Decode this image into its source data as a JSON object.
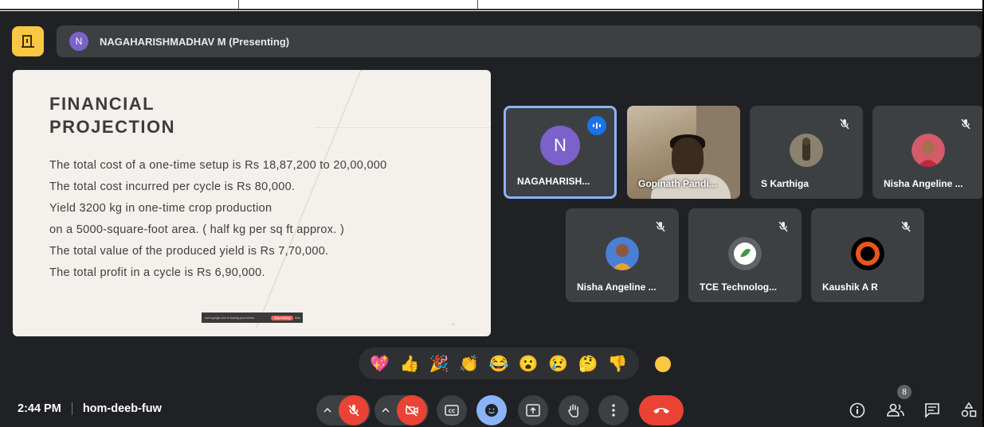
{
  "header": {
    "presenter_initial": "N",
    "presenter_text": "NAGAHARISHMADHAV M (Presenting)"
  },
  "slide": {
    "title_line1": "FINANCIAL",
    "title_line2": "PROJECTION",
    "lines": [
      "The total cost of a one-time setup is Rs 18,87,200 to 20,00,000",
      "The total cost incurred per cycle is Rs 80,000.",
      "Yield 3200 kg in one-time crop production",
      "on a 5000-square-foot area. ( half kg per sq ft approx. )",
      "The total value of the produced yield is Rs 7,70,000.",
      "The total profit in a cycle is Rs 6,90,000."
    ],
    "sharebar_text": "meet.google.com is sharing your screen.",
    "sharebar_stop": "Stop sharing",
    "sharebar_hide": "Hide"
  },
  "participants": [
    {
      "name": "NAGAHARISH...",
      "initial": "N",
      "speaking": true
    },
    {
      "name": "Gopinath Pandi..."
    },
    {
      "name": "S Karthiga"
    },
    {
      "name": "Nisha Angeline ..."
    },
    {
      "name": "Nisha Angeline ..."
    },
    {
      "name": "TCE Technolog..."
    },
    {
      "name": "Kaushik A R"
    }
  ],
  "reactions": [
    "💖",
    "👍",
    "🎉",
    "👏",
    "😂",
    "😮",
    "😢",
    "🤔",
    "👎"
  ],
  "footer": {
    "time": "2:44 PM",
    "meeting_code": "hom-deeb-fuw",
    "people_count": "8"
  },
  "colors": {
    "background": "#202124",
    "tile": "#3c4043",
    "accent_blue": "#8ab4f8",
    "danger_red": "#ea4335",
    "app_yellow": "#f9c743"
  }
}
